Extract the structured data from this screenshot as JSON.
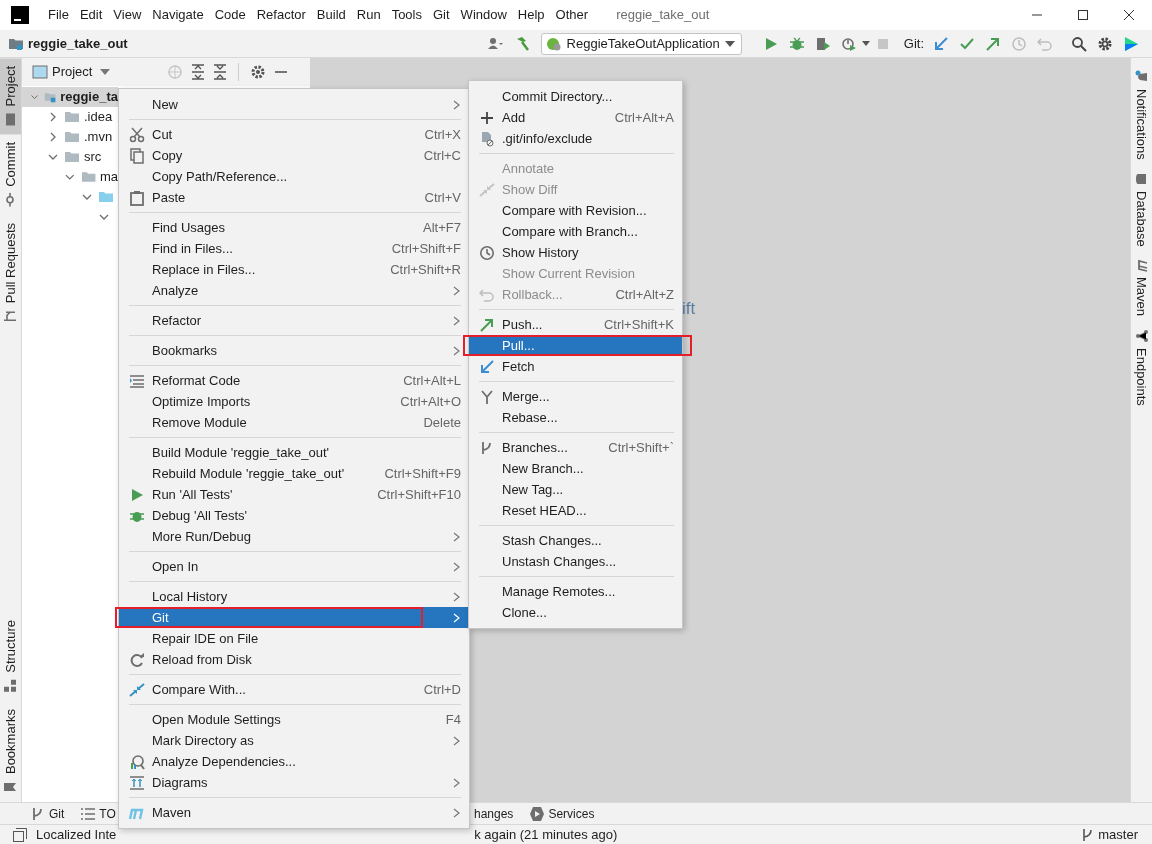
{
  "window": {
    "title": "reggie_take_out"
  },
  "menu_bar": [
    "File",
    "Edit",
    "View",
    "Navigate",
    "Code",
    "Refactor",
    "Build",
    "Run",
    "Tools",
    "Git",
    "Window",
    "Help",
    "Other"
  ],
  "toolbar": {
    "project": "reggie_take_out",
    "run_configuration": "ReggieTakeOutApplication",
    "git_label": "Git:"
  },
  "left_tool_strip": [
    {
      "label": "Project",
      "selected": true
    },
    {
      "label": "Commit",
      "selected": false
    },
    {
      "label": "Pull Requests",
      "selected": false
    },
    {
      "label": "Structure",
      "selected": false
    },
    {
      "label": "Bookmarks",
      "selected": false
    }
  ],
  "right_tool_strip": [
    "Notifications",
    "Database",
    "Maven",
    "Endpoints"
  ],
  "project_panel": {
    "title": "Project",
    "tree": [
      {
        "label": "reggie_ta",
        "bold": true,
        "expanded": true,
        "selected": true,
        "children": [
          {
            "label": ".idea",
            "bold": false,
            "expanded": false,
            "selected": false
          },
          {
            "label": ".mvn",
            "bold": false,
            "expanded": false,
            "selected": false
          },
          {
            "label": "src",
            "bold": false,
            "expanded": true,
            "selected": false,
            "children": [
              {
                "label": "ma",
                "bold": false,
                "expanded": true,
                "selected": false,
                "children": [
                  {
                    "expanded": true,
                    "selected": false,
                    "children": [
                      {
                        "expanded": true,
                        "selected": false
                      }
                    ]
                  }
                ]
              }
            ]
          }
        ]
      }
    ]
  },
  "editor_hint": "ift",
  "context_menu": {
    "groups": [
      [
        {
          "label": "New",
          "has_submenu": true,
          "selected": false,
          "marked": false
        }
      ],
      [
        {
          "label": "Cut",
          "shortcut": "Ctrl+X",
          "has_submenu": false,
          "selected": false,
          "marked": false
        },
        {
          "label": "Copy",
          "shortcut": "Ctrl+C",
          "has_submenu": false,
          "selected": false,
          "marked": false
        },
        {
          "label": "Copy Path/Reference...",
          "has_submenu": false,
          "selected": false,
          "marked": false
        },
        {
          "label": "Paste",
          "shortcut": "Ctrl+V",
          "has_submenu": false,
          "selected": false,
          "marked": false
        }
      ],
      [
        {
          "label": "Find Usages",
          "shortcut": "Alt+F7",
          "has_submenu": false,
          "selected": false,
          "marked": false
        },
        {
          "label": "Find in Files...",
          "shortcut": "Ctrl+Shift+F",
          "has_submenu": false,
          "selected": false,
          "marked": false
        },
        {
          "label": "Replace in Files...",
          "shortcut": "Ctrl+Shift+R",
          "has_submenu": false,
          "selected": false,
          "marked": false
        },
        {
          "label": "Analyze",
          "has_submenu": true,
          "selected": false,
          "marked": false
        }
      ],
      [
        {
          "label": "Refactor",
          "has_submenu": true,
          "selected": false,
          "marked": false
        }
      ],
      [
        {
          "label": "Bookmarks",
          "has_submenu": true,
          "selected": false,
          "marked": false
        }
      ],
      [
        {
          "label": "Reformat Code",
          "shortcut": "Ctrl+Alt+L",
          "has_submenu": false,
          "selected": false,
          "marked": false
        },
        {
          "label": "Optimize Imports",
          "shortcut": "Ctrl+Alt+O",
          "has_submenu": false,
          "selected": false,
          "marked": false
        },
        {
          "label": "Remove Module",
          "shortcut": "Delete",
          "has_submenu": false,
          "selected": false,
          "marked": false
        }
      ],
      [
        {
          "label": "Build Module 'reggie_take_out'",
          "has_submenu": false,
          "selected": false,
          "marked": false
        },
        {
          "label": "Rebuild Module 'reggie_take_out'",
          "shortcut": "Ctrl+Shift+F9",
          "has_submenu": false,
          "selected": false,
          "marked": false
        },
        {
          "label": "Run 'All Tests'",
          "shortcut": "Ctrl+Shift+F10",
          "has_submenu": false,
          "selected": false,
          "marked": false
        },
        {
          "label": "Debug 'All Tests'",
          "has_submenu": false,
          "selected": false,
          "marked": false
        },
        {
          "label": "More Run/Debug",
          "has_submenu": true,
          "selected": false,
          "marked": false
        }
      ],
      [
        {
          "label": "Open In",
          "has_submenu": true,
          "selected": false,
          "marked": false
        }
      ],
      [
        {
          "label": "Local History",
          "has_submenu": true,
          "selected": false,
          "marked": false
        },
        {
          "label": "Git",
          "has_submenu": true,
          "selected": true,
          "marked": true
        },
        {
          "label": "Repair IDE on File",
          "has_submenu": false,
          "selected": false,
          "marked": false
        },
        {
          "label": "Reload from Disk",
          "has_submenu": false,
          "selected": false,
          "marked": false
        }
      ],
      [
        {
          "label": "Compare With...",
          "shortcut": "Ctrl+D",
          "has_submenu": false,
          "selected": false,
          "marked": false
        }
      ],
      [
        {
          "label": "Open Module Settings",
          "shortcut": "F4",
          "has_submenu": false,
          "selected": false,
          "marked": false
        },
        {
          "label": "Mark Directory as",
          "has_submenu": true,
          "selected": false,
          "marked": false
        },
        {
          "label": "Analyze Dependencies...",
          "has_submenu": false,
          "selected": false,
          "marked": false
        },
        {
          "label": "Diagrams",
          "has_submenu": true,
          "selected": false,
          "marked": false
        }
      ],
      [
        {
          "label": "Maven",
          "has_submenu": true,
          "selected": false,
          "marked": false
        }
      ]
    ]
  },
  "git_submenu": {
    "groups": [
      [
        {
          "label": "Commit Directory...",
          "disabled": false,
          "selected": false,
          "marked": false
        },
        {
          "label": "Add",
          "shortcut": "Ctrl+Alt+A",
          "disabled": false,
          "selected": false,
          "marked": false
        },
        {
          "label": ".git/info/exclude",
          "disabled": false,
          "selected": false,
          "marked": false
        }
      ],
      [
        {
          "label": "Annotate",
          "disabled": true,
          "selected": false,
          "marked": false
        },
        {
          "label": "Show Diff",
          "disabled": true,
          "selected": false,
          "marked": false
        },
        {
          "label": "Compare with Revision...",
          "disabled": false,
          "selected": false,
          "marked": false
        },
        {
          "label": "Compare with Branch...",
          "disabled": false,
          "selected": false,
          "marked": false
        },
        {
          "label": "Show History",
          "disabled": false,
          "selected": false,
          "marked": false
        },
        {
          "label": "Show Current Revision",
          "disabled": true,
          "selected": false,
          "marked": false
        },
        {
          "label": "Rollback...",
          "shortcut": "Ctrl+Alt+Z",
          "disabled": true,
          "selected": false,
          "marked": false
        }
      ],
      [
        {
          "label": "Push...",
          "shortcut": "Ctrl+Shift+K",
          "disabled": false,
          "selected": false,
          "marked": false
        },
        {
          "label": "Pull...",
          "disabled": false,
          "selected": true,
          "marked": true
        },
        {
          "label": "Fetch",
          "disabled": false,
          "selected": false,
          "marked": false
        }
      ],
      [
        {
          "label": "Merge...",
          "disabled": false,
          "selected": false,
          "marked": false
        },
        {
          "label": "Rebase...",
          "disabled": false,
          "selected": false,
          "marked": false
        }
      ],
      [
        {
          "label": "Branches...",
          "shortcut": "Ctrl+Shift+`",
          "disabled": false,
          "selected": false,
          "marked": false
        },
        {
          "label": "New Branch...",
          "disabled": false,
          "selected": false,
          "marked": false
        },
        {
          "label": "New Tag...",
          "disabled": false,
          "selected": false,
          "marked": false
        },
        {
          "label": "Reset HEAD...",
          "disabled": false,
          "selected": false,
          "marked": false
        }
      ],
      [
        {
          "label": "Stash Changes...",
          "disabled": false,
          "selected": false,
          "marked": false
        },
        {
          "label": "Unstash Changes...",
          "disabled": false,
          "selected": false,
          "marked": false
        }
      ],
      [
        {
          "label": "Manage Remotes...",
          "disabled": false,
          "selected": false,
          "marked": false
        },
        {
          "label": "Clone...",
          "disabled": false,
          "selected": false,
          "marked": false
        }
      ]
    ]
  },
  "tool_tabs": [
    "Git",
    "TO",
    "hanges",
    "Services"
  ],
  "status_bar": {
    "message": "Localized Inte",
    "message_tail": "k again (21 minutes ago)",
    "branch": "master"
  }
}
